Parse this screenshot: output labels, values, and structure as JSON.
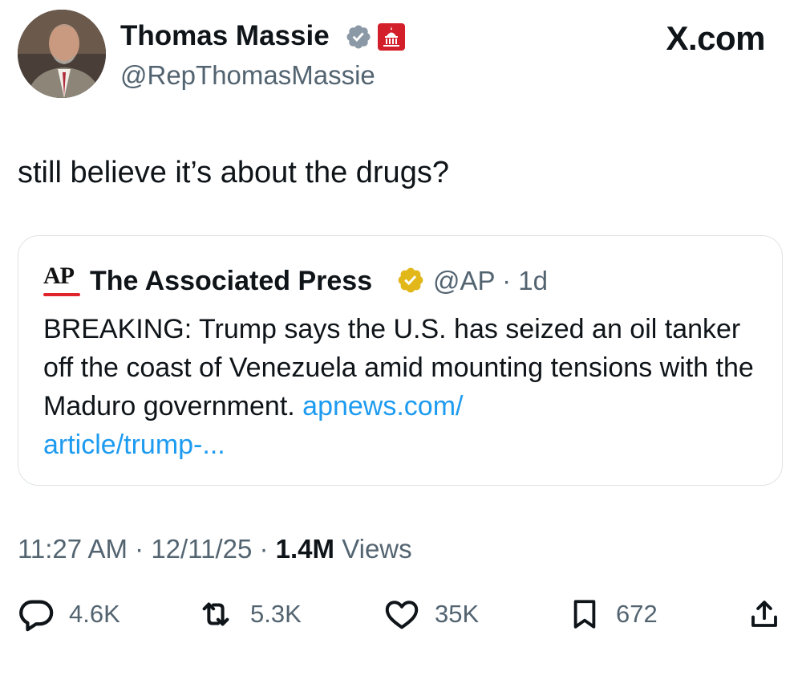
{
  "author": {
    "name": "Thomas Massie",
    "handle": "@RepThomasMassie",
    "verified_icon": "verified-badge-icon",
    "affiliation_icon": "capitol-badge-icon"
  },
  "site": "X.com",
  "tweet": {
    "text": "still believe it’s about the drugs?"
  },
  "quoted": {
    "logo_text": "AP",
    "name": "The Associated Press",
    "handle": "@AP",
    "separator": " · ",
    "age": "1d",
    "body": "BREAKING: Trump says the U.S. has seized an oil tanker off the coast of Venezuela amid mounting tensions with the Maduro government. ",
    "link_line1": "apnews.com/",
    "link_line2": "article/trump-..."
  },
  "meta": {
    "time": "11:27 AM",
    "date": "12/11/25",
    "views_count": "1.4M",
    "views_label": "Views",
    "sep": " · "
  },
  "actions": {
    "replies": "4.6K",
    "reposts": "5.3K",
    "likes": "35K",
    "bookmarks": "672"
  },
  "colors": {
    "text": "#0f1419",
    "secondary": "#536471",
    "link": "#1d9bf0",
    "ap_red": "#e0242b",
    "verified_blue": "#1d9bf0",
    "verified_gold": "#e2b719",
    "capitol_red": "#d21f2a"
  }
}
